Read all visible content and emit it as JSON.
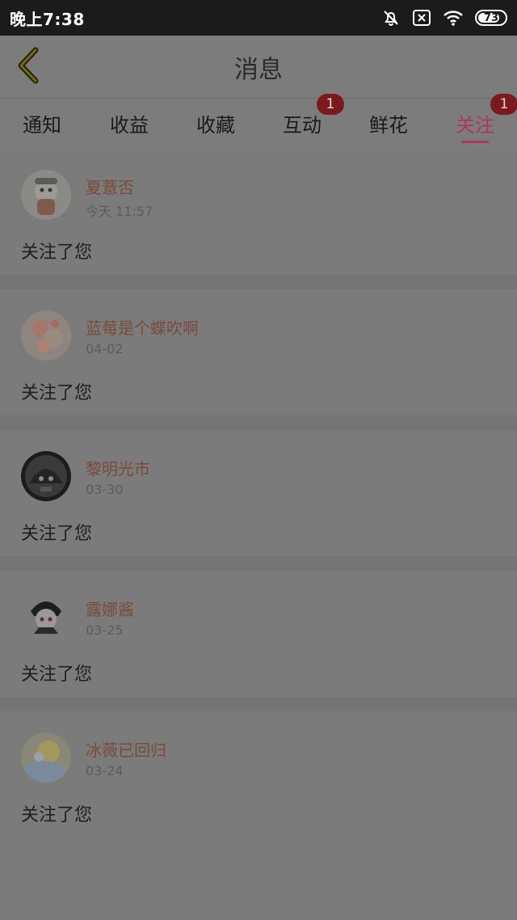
{
  "status_bar": {
    "time": "晚上7:38",
    "battery": "73"
  },
  "header": {
    "title": "消息"
  },
  "tabs": [
    {
      "label": "通知",
      "badge": ""
    },
    {
      "label": "收益",
      "badge": ""
    },
    {
      "label": "收藏",
      "badge": ""
    },
    {
      "label": "互动",
      "badge": "1"
    },
    {
      "label": "鲜花",
      "badge": ""
    },
    {
      "label": "关注",
      "badge": "1",
      "active": true
    }
  ],
  "colors": {
    "accent": "#b0355e",
    "username": "#7a4b3a",
    "badge": "#7a1a1d"
  },
  "messages": [
    {
      "user": "夏薏否",
      "time": "今天 11:57",
      "action": "关注了您"
    },
    {
      "user": "蓝莓是个蝶吹啊",
      "time": "04-02",
      "action": "关注了您"
    },
    {
      "user": "黎明光市",
      "time": "03-30",
      "action": "关注了您"
    },
    {
      "user": "露娜酱",
      "time": "03-25",
      "action": "关注了您"
    },
    {
      "user": "冰薇已回归",
      "time": "03-24",
      "action": "关注了您"
    }
  ]
}
